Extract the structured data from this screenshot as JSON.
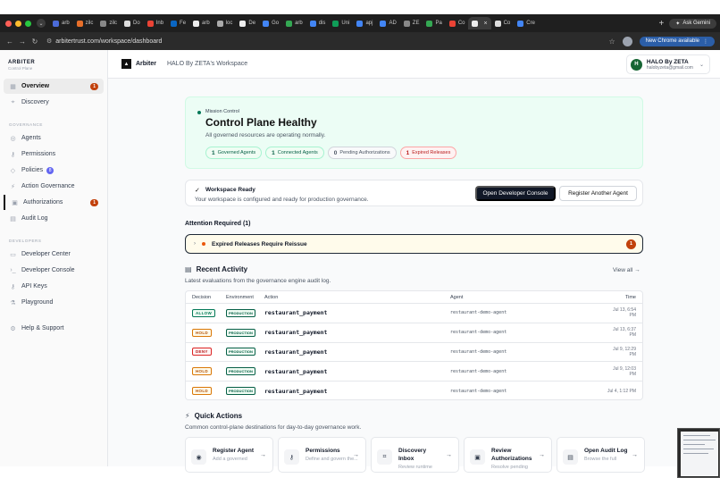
{
  "browser": {
    "tabs": [
      {
        "label": "arb",
        "color": "#4b6bd8"
      },
      {
        "label": "zilc",
        "color": "#e76f2a"
      },
      {
        "label": "zilc",
        "color": "#888888"
      },
      {
        "label": "Do",
        "color": "#dddddd"
      },
      {
        "label": "Inb",
        "color": "#ea4335"
      },
      {
        "label": "Fe",
        "color": "#0a66c2"
      },
      {
        "label": "arb",
        "color": "#eeeeee"
      },
      {
        "label": "loc",
        "color": "#aaaaaa"
      },
      {
        "label": "De",
        "color": "#eeeeee"
      },
      {
        "label": "Go",
        "color": "#4285f4"
      },
      {
        "label": "arb",
        "color": "#34a853"
      },
      {
        "label": "dis",
        "color": "#4285f4"
      },
      {
        "label": "Uni",
        "color": "#0f9d58"
      },
      {
        "label": "apj",
        "color": "#4285f4"
      },
      {
        "label": "AD",
        "color": "#4285f4"
      },
      {
        "label": "ZE",
        "color": "#888888"
      },
      {
        "label": "Pa",
        "color": "#34a853"
      },
      {
        "label": "Co",
        "color": "#ea4335"
      },
      {
        "label": "",
        "color": "#eeeeee",
        "active": true
      },
      {
        "label": "Co",
        "color": "#dddddd"
      },
      {
        "label": "Cre",
        "color": "#4285f4"
      }
    ],
    "ask_gemini": "Ask Gemini",
    "url": "arbitertrust.com/workspace/dashboard",
    "new_chrome": "New Chrome available"
  },
  "sidebar": {
    "brand": "ARBITER",
    "brand_sub": "Control Plane",
    "top_items": [
      {
        "label": "Overview",
        "icon": "grid-icon",
        "badge": "1",
        "active": true
      },
      {
        "label": "Discovery",
        "icon": "discovery-icon"
      }
    ],
    "governance_label": "GOVERNANCE",
    "governance_items": [
      {
        "label": "Agents",
        "icon": "agents-icon"
      },
      {
        "label": "Permissions",
        "icon": "key-icon"
      },
      {
        "label": "Policies",
        "icon": "policy-icon",
        "badge": "8"
      },
      {
        "label": "Action Governance",
        "icon": "bolt-icon"
      },
      {
        "label": "Authorizations",
        "icon": "clipboard-icon",
        "badge": "1"
      },
      {
        "label": "Audit Log",
        "icon": "log-icon"
      }
    ],
    "developers_label": "DEVELOPERS",
    "developer_items": [
      {
        "label": "Developer Center",
        "icon": "terminal-icon"
      },
      {
        "label": "Developer Console",
        "icon": "console-icon"
      },
      {
        "label": "API Keys",
        "icon": "key-icon"
      },
      {
        "label": "Playground",
        "icon": "flask-icon"
      }
    ],
    "help": "Help & Support"
  },
  "topbar": {
    "logo_name": "Arbiter",
    "workspace": "HALO By ZETA's Workspace",
    "user_initial": "H",
    "user_name": "HALO By ZETA",
    "user_email": "halobyzeta@gmail.com"
  },
  "hero": {
    "kicker": "Mission Control",
    "title": "Control Plane Healthy",
    "desc": "All governed resources are operating normally.",
    "pills": [
      {
        "count": "1",
        "label": "Governed Agents"
      },
      {
        "count": "1",
        "label": "Connected Agents"
      },
      {
        "count": "0",
        "label": "Pending Authorizations"
      },
      {
        "count": "1",
        "label": "Expired Releases"
      }
    ]
  },
  "ready": {
    "title": "Workspace Ready",
    "desc": "Your workspace is configured and ready for production governance.",
    "primary": "Open Developer Console",
    "secondary": "Register Another Agent"
  },
  "attention": {
    "heading": "Attention Required (1)",
    "item": "Expired Releases Require Reissue",
    "badge": "1"
  },
  "activity": {
    "title": "Recent Activity",
    "subtitle": "Latest evaluations from the governance engine audit log.",
    "view_all": "View all →",
    "columns": [
      "Decision",
      "Environment",
      "Action",
      "Agent",
      "Time"
    ],
    "rows": [
      {
        "decision": "ALLOW",
        "env": "PRODUCTION",
        "action": "restaurant_payment",
        "agent": "restaurant-demo-agent",
        "time": "Jul 13, 6:54 PM"
      },
      {
        "decision": "HOLD",
        "env": "PRODUCTION",
        "action": "restaurant_payment",
        "agent": "restaurant-demo-agent",
        "time": "Jul 13, 6:37 PM"
      },
      {
        "decision": "DENY",
        "env": "PRODUCTION",
        "action": "restaurant_payment",
        "agent": "restaurant-demo-agent",
        "time": "Jul 9, 12:29 PM"
      },
      {
        "decision": "HOLD",
        "env": "PRODUCTION",
        "action": "restaurant_payment",
        "agent": "restaurant-demo-agent",
        "time": "Jul 9, 12:03 PM"
      },
      {
        "decision": "HOLD",
        "env": "PRODUCTION",
        "action": "restaurant_payment",
        "agent": "restaurant-demo-agent",
        "time": "Jul 4, 1:12 PM"
      }
    ]
  },
  "quick": {
    "title": "Quick Actions",
    "subtitle": "Common control-plane destinations for day-to-day governance work.",
    "cards": [
      {
        "title": "Register Agent",
        "desc": "Add a governed",
        "icon": "robot-icon"
      },
      {
        "title": "Permissions",
        "desc": "Define and govern the...",
        "icon": "key-icon"
      },
      {
        "title": "Discovery Inbox",
        "desc": "Review runtime",
        "icon": "scan-icon"
      },
      {
        "title": "Review Authorizations",
        "desc": "Resolve pending",
        "icon": "clipboard-icon"
      },
      {
        "title": "Open Audit Log",
        "desc": "Browse the full",
        "icon": "log-icon"
      }
    ]
  },
  "colors": {
    "accent": "#111827",
    "healthy_bg": "#ecfdf5",
    "badge": "#c2410c"
  }
}
